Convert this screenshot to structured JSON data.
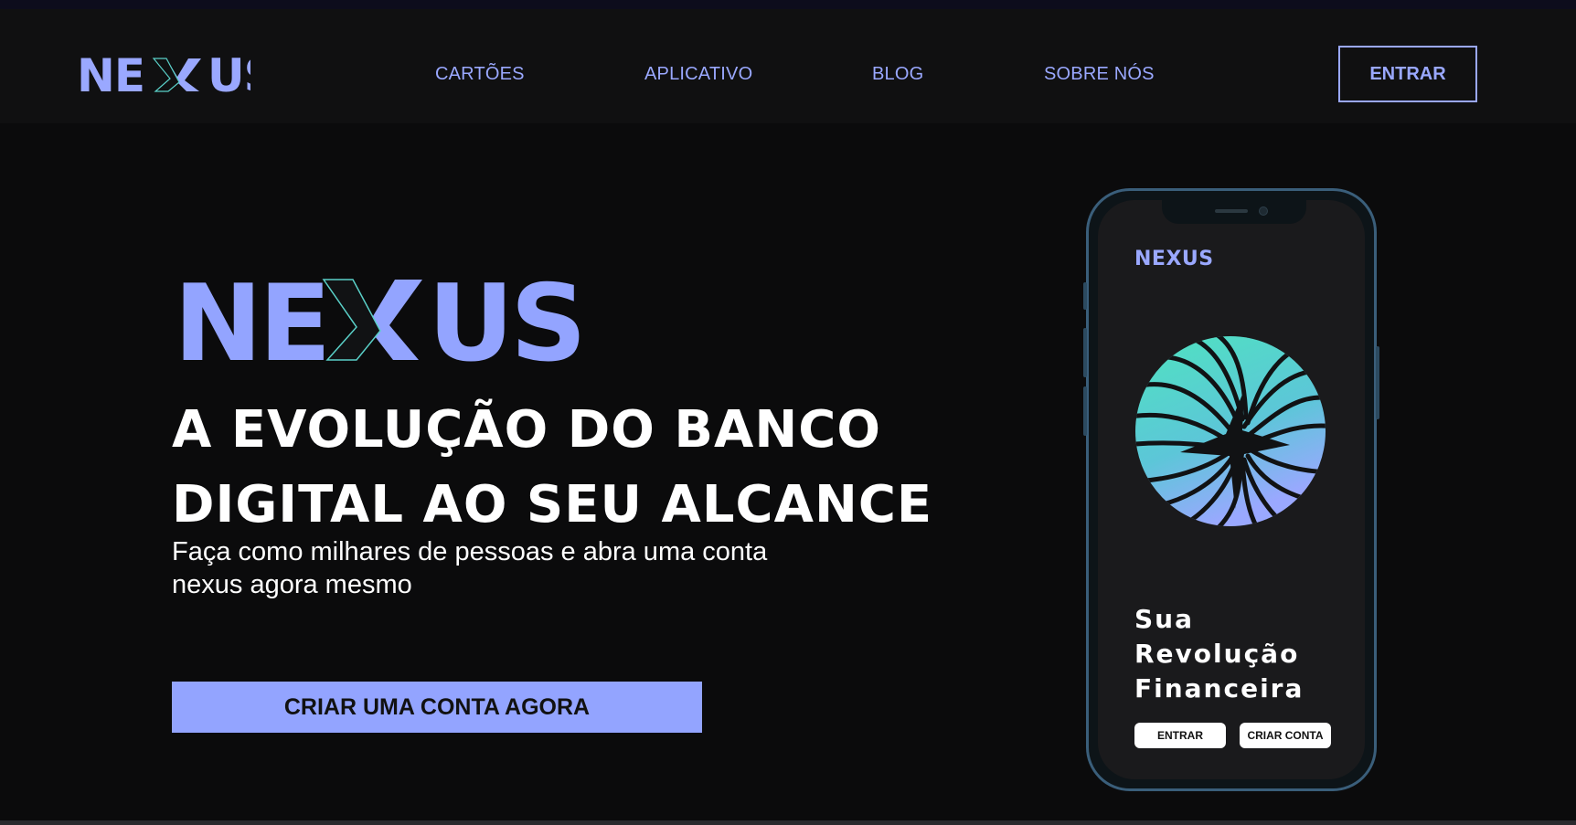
{
  "brand": {
    "logo_text": "NEXUS",
    "primary_color": "#9aa8ff",
    "accent_color": "#5ad0c8",
    "background": "#0b0b0c"
  },
  "nav": {
    "items": [
      {
        "label": "CARTÕES"
      },
      {
        "label": "APLICATIVO"
      },
      {
        "label": "BLOG"
      },
      {
        "label": "SOBRE NÓS"
      }
    ],
    "login_label": "ENTRAR"
  },
  "hero": {
    "logo_text": "NEXUS",
    "headline_line1": "A EVOLUÇÃO DO BANCO",
    "headline_line2": "DIGITAL AO SEU ALCANCE",
    "subtext_line1": "Faça como milhares de pessoas e abra uma conta",
    "subtext_line2": "nexus agora mesmo",
    "cta_label": "CRIAR UMA CONTA AGORA"
  },
  "phone": {
    "logo_text": "NEXUS",
    "title_line1": "Sua",
    "title_line2": "Revolução",
    "title_line3": "Financeira",
    "login_label": "ENTRAR",
    "signup_label": "CRIAR CONTA",
    "art_icon": "wave-globe-graphic"
  }
}
